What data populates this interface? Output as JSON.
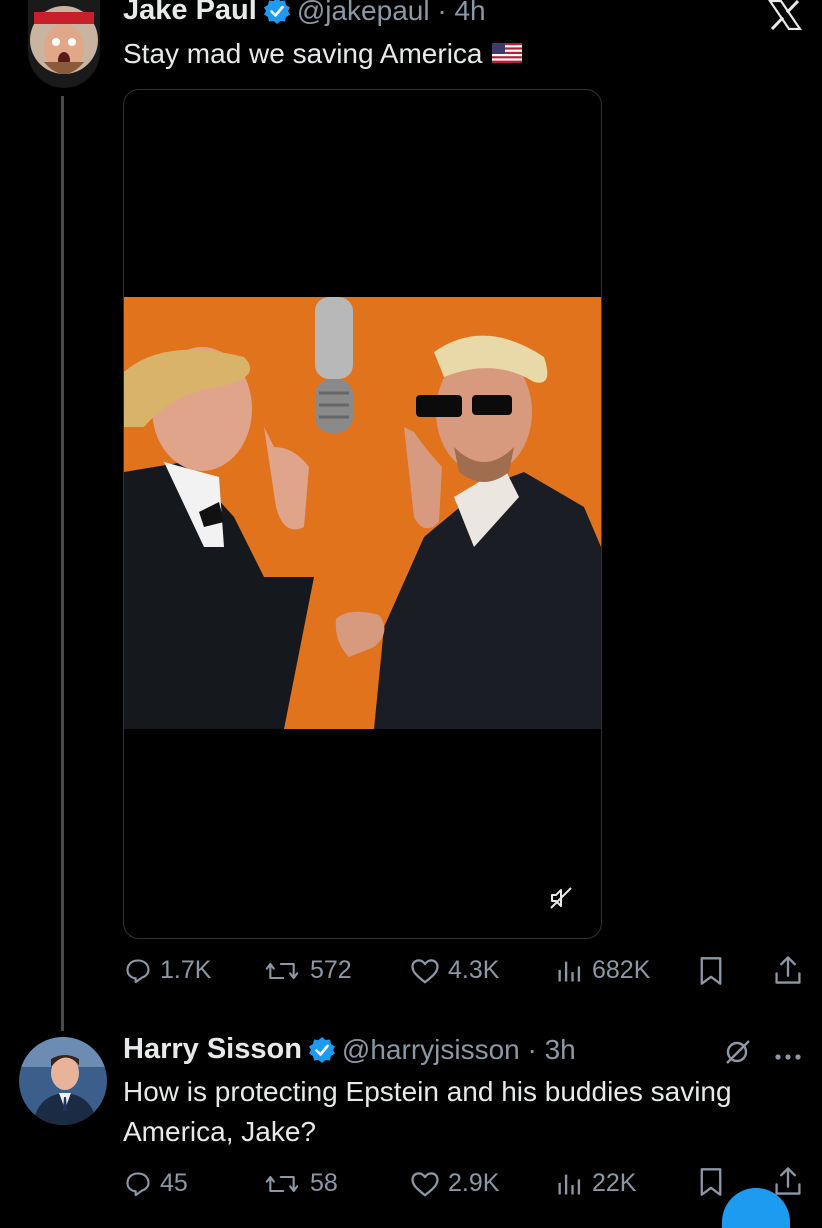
{
  "brand": {
    "logo_icon": "x-logo-icon"
  },
  "tweet": {
    "author_name": "Jake Paul",
    "handle_time": "@jakepaul · 4h",
    "text": "Stay mad we saving America",
    "flag": "us-flag-icon",
    "stats": {
      "replies": "1.7K",
      "reposts": "572",
      "likes": "4.3K",
      "views": "682K"
    }
  },
  "reply": {
    "author_name": "Harry Sisson",
    "handle_time": "@harryjsisson · 3h",
    "text": "How is protecting Epstein and his buddies saving America, Jake?",
    "stats": {
      "replies": "45",
      "reposts": "58",
      "likes": "2.9K",
      "views": "22K"
    }
  },
  "colors": {
    "background": "#000000",
    "text": "#e7e9ea",
    "muted": "#8b98a5",
    "verified": "#1d9bf0",
    "photo_backdrop": "#e0731c"
  }
}
